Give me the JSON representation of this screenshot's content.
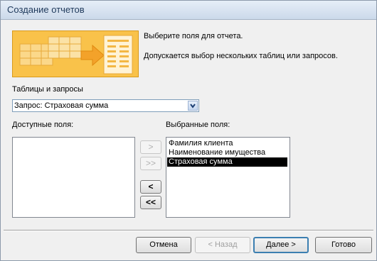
{
  "window": {
    "title": "Создание отчетов"
  },
  "header": {
    "line1": "Выберите поля для отчета.",
    "line2": "Допускается выбор нескольких таблиц или запросов."
  },
  "tables": {
    "label": "Таблицы и запросы",
    "selected": "Запрос: Страховая сумма"
  },
  "available": {
    "label": "Доступные поля:",
    "items": []
  },
  "selected": {
    "label": "Выбранные поля:",
    "items": [
      "Фамилия клиента",
      "Наименование имущества",
      "Страховая сумма"
    ],
    "highlighted_index": 2
  },
  "move_buttons": {
    "add": ">",
    "add_all": ">>",
    "remove": "<",
    "remove_all": "<<"
  },
  "footer": {
    "cancel": "Отмена",
    "back": "< Назад",
    "next": "Далее >",
    "finish": "Готово"
  },
  "colors": {
    "banner": "#f9c24a",
    "selection": "#000000",
    "accent": "#3c7fb1"
  },
  "icons": {
    "banner": "report-wizard-graphic",
    "combo_arrow": "chevron-down-icon"
  }
}
